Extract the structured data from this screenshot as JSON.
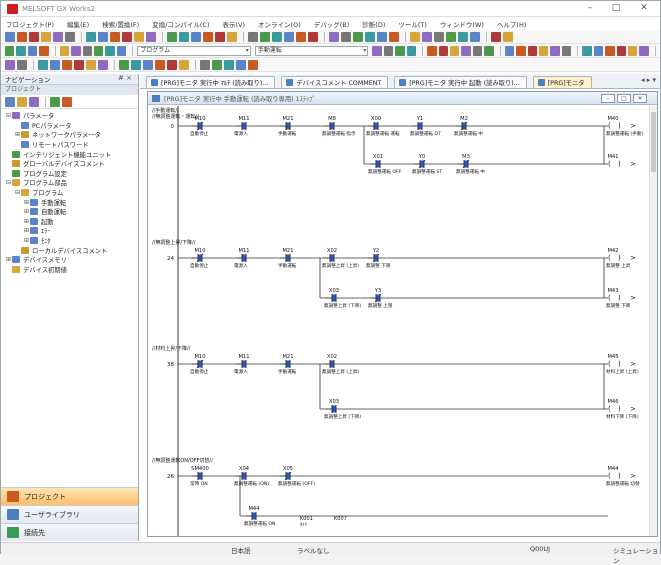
{
  "app": {
    "title": "MELSOFT GX Works2"
  },
  "window_controls": {
    "minimize": "–",
    "maximize": "□",
    "close": "✕"
  },
  "menu": [
    "プロジェクト(P)",
    "編集(E)",
    "検索/置換(F)",
    "変換/コンパイル(C)",
    "表示(V)",
    "オンライン(O)",
    "デバッグ(B)",
    "診断(D)",
    "ツール(T)",
    "ウィンドウ(W)",
    "ヘルプ(H)"
  ],
  "toolbar": {
    "program_combo": "プログラム",
    "manual_combo": "手動運転"
  },
  "nav": {
    "title": "ナビゲーション",
    "controls": "# ×",
    "header": "プロジェクト",
    "tree": [
      {
        "label": "パラメータ",
        "depth": 0,
        "exp": "⊟",
        "color": "#8e6bbf"
      },
      {
        "label": "PCパラメータ",
        "depth": 1,
        "exp": "",
        "color": "#5b83c7"
      },
      {
        "label": "ネットワークパラメータ",
        "depth": 1,
        "exp": "⊞",
        "color": "#c99b2f"
      },
      {
        "label": "リモートパスワード",
        "depth": 1,
        "exp": "",
        "color": "#5b83c7"
      },
      {
        "label": "インテリジェント機能ユニット",
        "depth": 0,
        "exp": "",
        "color": "#4b9a4b"
      },
      {
        "label": "グローバルデバイスコメント",
        "depth": 0,
        "exp": "",
        "color": "#c99b2f"
      },
      {
        "label": "プログラム設定",
        "depth": 0,
        "exp": "",
        "color": "#4b9a4b"
      },
      {
        "label": "プログラム部品",
        "depth": 0,
        "exp": "⊟",
        "color": "#d8a53a"
      },
      {
        "label": "プログラム",
        "depth": 1,
        "exp": "⊟",
        "color": "#d8a53a"
      },
      {
        "label": "手動運転",
        "depth": 2,
        "exp": "⊞",
        "color": "#5b83c7"
      },
      {
        "label": "自動運転",
        "depth": 2,
        "exp": "⊞",
        "color": "#5b83c7"
      },
      {
        "label": "起動",
        "depth": 2,
        "exp": "⊞",
        "color": "#5b83c7"
      },
      {
        "label": "ｴﾗｰ",
        "depth": 2,
        "exp": "⊞",
        "color": "#5b83c7"
      },
      {
        "label": "ﾓﾆﾀ",
        "depth": 2,
        "exp": "⊞",
        "color": "#5b83c7"
      },
      {
        "label": "ローカルデバイスコメント",
        "depth": 1,
        "exp": "",
        "color": "#c99b2f"
      },
      {
        "label": "デバイスメモリ",
        "depth": 0,
        "exp": "⊞",
        "color": "#5b83c7"
      },
      {
        "label": "デバイス初期値",
        "depth": 0,
        "exp": "",
        "color": "#d8a53a"
      }
    ],
    "footer": [
      {
        "label": "プロジェクト",
        "active": true,
        "color": "#c85a22"
      },
      {
        "label": "ユーザライブラリ",
        "active": false,
        "color": "#4a7fc0"
      },
      {
        "label": "接続先",
        "active": false,
        "color": "#3a9a5a"
      }
    ]
  },
  "tabs": [
    {
      "label": "[PRG]モニタ 実行中 ﾏﾙﾁ (読み取り)...",
      "active": false
    },
    {
      "label": "デバイスコメント COMMENT",
      "active": false
    },
    {
      "label": "[PRG]モニタ 実行中 起動 (読み取り)...",
      "active": false
    },
    {
      "label": "[PRG]モニタ",
      "active": true
    }
  ],
  "tab_scroll": "◂ ▸ ▾",
  "ladder_window": {
    "title": "[PRG]モニタ 実行中 手動運転 (読み取り専用) 1ｽﾃｯﾌﾟ"
  },
  "ladder": {
    "rungs": [
      {
        "comment1": "//手動運転//",
        "comment2": "//無調整運転・運転//",
        "step": "0",
        "contacts": [
          {
            "dev": "M10",
            "cmt": "自動停止",
            "type": "nc"
          },
          {
            "dev": "M11",
            "cmt": "電源入",
            "type": "no"
          },
          {
            "dev": "M21",
            "cmt": "手動運転",
            "type": "no"
          },
          {
            "dev": "M8",
            "cmt": "無調整運転 指示",
            "type": "no"
          },
          {
            "dev": "X00",
            "cmt": "無調整運転 運転",
            "type": "no"
          },
          {
            "dev": "Y1",
            "cmt": "無調整運転 DT",
            "type": "no"
          },
          {
            "dev": "M2",
            "cmt": "無調整運転 中",
            "type": "nc"
          }
        ],
        "coil": {
          "dev": "M40",
          "cmt": "無調整運転 (手動)"
        },
        "branch": {
          "contacts": [
            {
              "dev": "X01",
              "cmt": "無調整運転 OFF",
              "type": "no"
            },
            {
              "dev": "Y0",
              "cmt": "無調整運転 ST",
              "type": "nc"
            },
            {
              "dev": "M3",
              "cmt": "無調整運転 中",
              "type": "nc"
            }
          ],
          "coil": {
            "dev": "M41",
            "cmt": ""
          }
        }
      },
      {
        "comment1": "//無調整上昇/下降//",
        "comment2": "",
        "step": "24",
        "contacts": [
          {
            "dev": "M10",
            "cmt": "自動停止",
            "type": "nc"
          },
          {
            "dev": "M11",
            "cmt": "電源入",
            "type": "no"
          },
          {
            "dev": "M21",
            "cmt": "手動運転",
            "type": "no"
          },
          {
            "dev": "X02",
            "cmt": "無調整上昇 (上昇)",
            "type": "no"
          },
          {
            "dev": "Y2",
            "cmt": "無調整 下限",
            "type": "nc"
          }
        ],
        "coil": {
          "dev": "M42",
          "cmt": "無調整 上昇"
        },
        "branch": {
          "contacts": [
            {
              "dev": "X03",
              "cmt": "無調整上昇 (下降)",
              "type": "no"
            },
            {
              "dev": "Y3",
              "cmt": "無調整 上限",
              "type": "nc"
            }
          ],
          "coil": {
            "dev": "M43",
            "cmt": "無調整 下降"
          }
        }
      },
      {
        "comment1": "//材料上昇/下降//",
        "comment2": "",
        "step": "38",
        "contacts": [
          {
            "dev": "M10",
            "cmt": "自動停止",
            "type": "nc"
          },
          {
            "dev": "M11",
            "cmt": "電源入",
            "type": "no"
          },
          {
            "dev": "M21",
            "cmt": "手動運転",
            "type": "no"
          },
          {
            "dev": "X02",
            "cmt": "無調整上昇 (上昇)",
            "type": "no"
          }
        ],
        "coil": {
          "dev": "M45",
          "cmt": "材料上昇 (上昇)"
        },
        "branch": {
          "contacts": [
            {
              "dev": "X03",
              "cmt": "無調整上昇 (下降)",
              "type": "no"
            }
          ],
          "coil": {
            "dev": "M46",
            "cmt": "材料下降 (下降)"
          }
        }
      },
      {
        "comment1": "//無調整運転ON/OFF切替//",
        "comment2": "",
        "step": "26",
        "contacts": [
          {
            "dev": "SM400",
            "cmt": "常時 ON",
            "type": "no"
          },
          {
            "dev": "X04",
            "cmt": "無調整運転 (ON)",
            "type": "no"
          },
          {
            "dev": "X05",
            "cmt": "無調整運転 (OFF)",
            "type": "nc"
          }
        ],
        "coil": {
          "dev": "M44",
          "cmt": "無調整運転 切替"
        },
        "branch": {
          "contacts": [
            {
              "dev": "M44",
              "cmt": "無調整運転 ON",
              "type": "no"
            }
          ],
          "extra": [
            {
              "dev": "K001",
              "cmt": "ﾀｲﾏ"
            },
            {
              "dev": "K007",
              "cmt": ""
            }
          ]
        }
      }
    ]
  },
  "status": {
    "lang": "日本語",
    "label": "ラベルなし",
    "cpu": "Q00UJ",
    "mode": "シミュレーション"
  }
}
